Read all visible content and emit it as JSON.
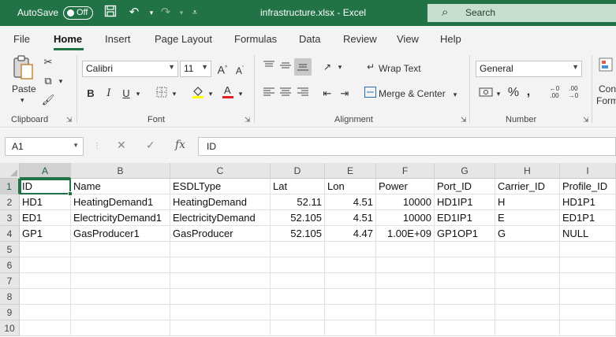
{
  "titlebar": {
    "autosave_label": "AutoSave",
    "autosave_state": "Off",
    "doc_title": "infrastructure.xlsx  -  Excel",
    "search_label": "Search",
    "accent": "#217346"
  },
  "menu": {
    "tabs": [
      "File",
      "Home",
      "Insert",
      "Page Layout",
      "Formulas",
      "Data",
      "Review",
      "View",
      "Help"
    ],
    "active": "Home"
  },
  "ribbon": {
    "clipboard": {
      "label": "Clipboard",
      "paste_label": "Paste"
    },
    "font": {
      "label": "Font",
      "font_name": "Calibri",
      "font_size": "11"
    },
    "alignment": {
      "label": "Alignment",
      "wrap_text": "Wrap Text",
      "merge_center": "Merge & Center"
    },
    "number": {
      "label": "Number",
      "format": "General"
    },
    "cut_off": {
      "line1": "Con",
      "line2": "Form"
    }
  },
  "formula_bar": {
    "name_box": "A1",
    "fx": "fx",
    "content": "ID"
  },
  "sheet": {
    "columns": [
      "A",
      "B",
      "C",
      "D",
      "E",
      "F",
      "G",
      "H",
      "I"
    ],
    "rows": [
      "1",
      "2",
      "3",
      "4",
      "5",
      "6",
      "7",
      "8",
      "9",
      "10"
    ],
    "cells": [
      [
        "ID",
        "Name",
        "ESDLType",
        "Lat",
        "Lon",
        "Power",
        "Port_ID",
        "Carrier_ID",
        "Profile_ID"
      ],
      [
        "HD1",
        "HeatingDemand1",
        "HeatingDemand",
        "52.11",
        "4.51",
        "10000",
        "HD1IP1",
        "H",
        "HD1P1"
      ],
      [
        "ED1",
        "ElectricityDemand1",
        "ElectricityDemand",
        "52.105",
        "4.51",
        "10000",
        "ED1IP1",
        "E",
        "ED1P1"
      ],
      [
        "GP1",
        "GasProducer1",
        "GasProducer",
        "52.105",
        "4.47",
        "1.00E+09",
        "GP1OP1",
        "G",
        "NULL"
      ]
    ]
  }
}
